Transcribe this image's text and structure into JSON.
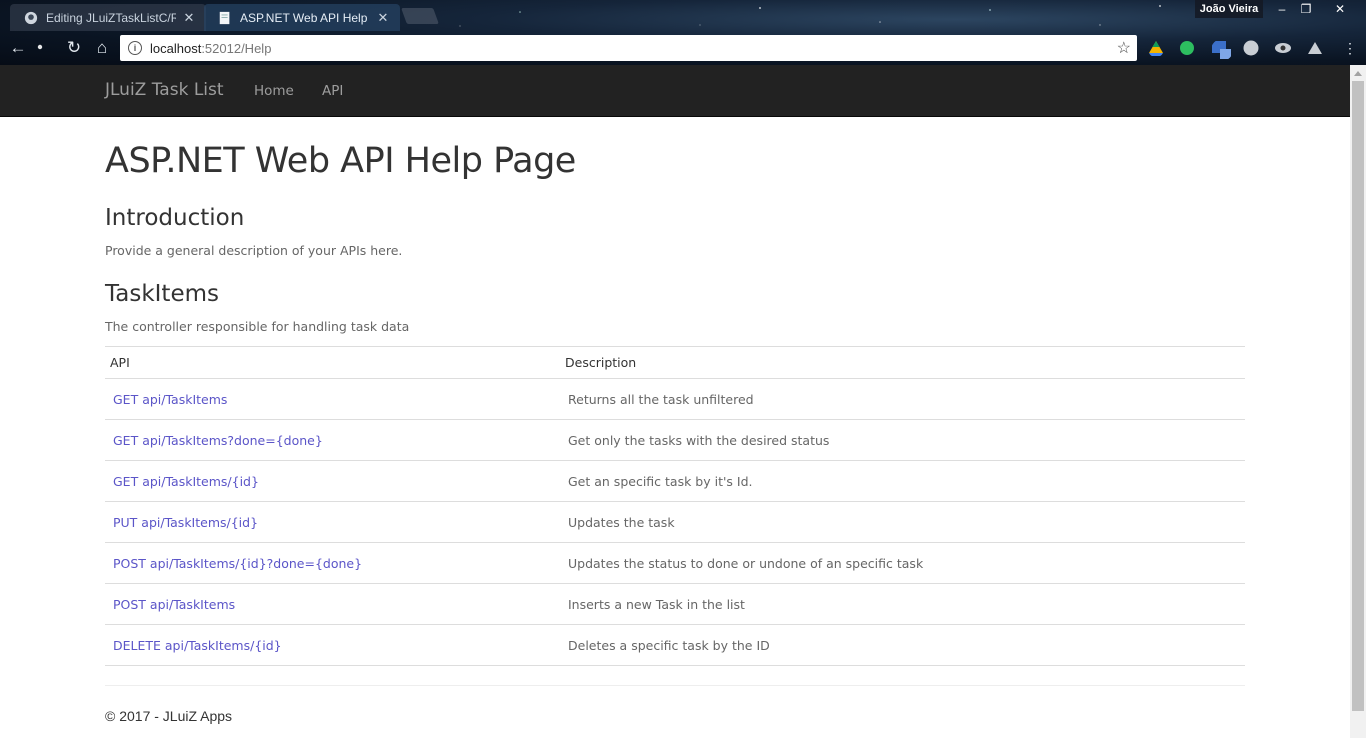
{
  "browser": {
    "tabs": [
      {
        "title": "Editing JLuiZTaskListC/RE",
        "active": false,
        "icon": "github-icon"
      },
      {
        "title": "ASP.NET Web API Help P",
        "active": true,
        "icon": "document-icon"
      }
    ],
    "profile_name": "João Vieira",
    "window_controls": {
      "minimize": "–",
      "restore": "❐",
      "close": "✕"
    },
    "url_host": "localhost",
    "url_rest": ":52012/Help",
    "extension_icons": [
      "google-drive-icon",
      "evernote-icon",
      "extension-icon",
      "compass-icon",
      "eye-icon",
      "drive-icon"
    ]
  },
  "navbar": {
    "brand": "JLuiZ Task List",
    "links": [
      "Home",
      "API"
    ]
  },
  "page": {
    "title": "ASP.NET Web API Help Page",
    "intro_heading": "Introduction",
    "intro_text": "Provide a general description of your APIs here.",
    "section_heading": "TaskItems",
    "section_text": "The controller responsible for handling task data",
    "table": {
      "headers": [
        "API",
        "Description"
      ],
      "rows": [
        {
          "api": "GET api/TaskItems",
          "description": "Returns all the task unfiltered"
        },
        {
          "api": "GET api/TaskItems?done={done}",
          "description": "Get only the tasks with the desired status"
        },
        {
          "api": "GET api/TaskItems/{id}",
          "description": "Get an specific task by it's Id."
        },
        {
          "api": "PUT api/TaskItems/{id}",
          "description": "Updates the task"
        },
        {
          "api": "POST api/TaskItems/{id}?done={done}",
          "description": "Updates the status to done or undone of an specific task"
        },
        {
          "api": "POST api/TaskItems",
          "description": "Inserts a new Task in the list"
        },
        {
          "api": "DELETE api/TaskItems/{id}",
          "description": "Deletes a specific task by the ID"
        }
      ]
    },
    "footer": "© 2017 - JLuiZ Apps"
  },
  "colors": {
    "navbar_bg": "#222222",
    "link": "#5b55c8",
    "nav_text": "#9d9d9d"
  }
}
